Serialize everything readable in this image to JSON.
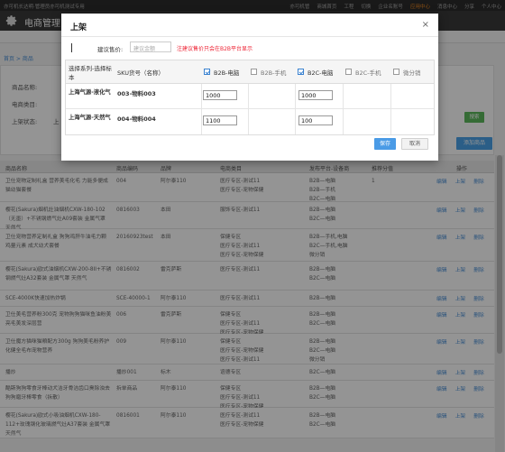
{
  "topbar": {
    "left_text": "亦可机长达明·管理员亦可机测试专用",
    "links": [
      "亦可机管",
      "商城首页",
      "工程",
      "切换",
      "企业名账号",
      "应用中心",
      "消息中心",
      "分享",
      "个人中心"
    ],
    "active_index": 5
  },
  "header": {
    "title": "电商管理"
  },
  "breadcrumb": "首页 > 商品",
  "form": {
    "goods_name_label": "商品名称:",
    "category_label": "电商类目:",
    "status_label": "上架状态:",
    "status_option": "上",
    "search_button": "搜索",
    "add_button": "添加商品"
  },
  "bg_table": {
    "headers": [
      "商品名称",
      "商品编码",
      "品牌",
      "电商类目",
      "发布平台-设备商",
      "推荐分值",
      "操作"
    ],
    "rows": [
      {
        "name": "卫仕宠物定制礼盒 营养美毛化毛 力能多便成猫幼猫套餐",
        "code": "004",
        "brand": "阿尔泰110",
        "category": "医疗专区-测试11\n医疗专区-宠物保健",
        "platform": "B2B—电脑\nB2B—手机\nB2C—电脑",
        "score": "1"
      },
      {
        "name": "樱花(Sakura)烟机灶油烟机CXW-180-102（无墨）+不锈钢燃气灶A09套装 金属气罩 天然气",
        "code": "0816003",
        "brand": "本田",
        "category": "服饰专区-测试11",
        "platform": "B2B—电脑\nB2C—电脑",
        "score": ""
      },
      {
        "name": "卫仕宠物营养定制礼盒 狗狗鸡肝牛油毛力颗 鸡量元素 成犬幼犬套餐",
        "code": "20160923test",
        "brand": "本田",
        "category": "保健专区\n医疗专区-测试11\n医疗专区-宠物保健",
        "platform": "B2B—手机,电脑\nB2C—手机,电脑\n微分销",
        "score": ""
      },
      {
        "name": "樱花(Sakura)欧式油烟机CXW-200-8II+不锈钢燃气灶A32套装 金属气罩 天然气",
        "code": "0816002",
        "brand": "雷克萨斯",
        "category": "医疗专区-测试11",
        "platform": "B2B—电脑\nB2C—电脑",
        "score": ""
      },
      {
        "name": "SCE-4000K快速加热炸锅",
        "code": "SCE-40000-1",
        "brand": "阿尔泰110",
        "category": "医疗专区-测试11",
        "platform": "B2B—电脑",
        "score": ""
      },
      {
        "name": "卫仕美毛营养粉300克 宠物狗狗猫咪鱼油粉美亮毛美发深层营",
        "code": "006",
        "brand": "雷克萨斯",
        "category": "保健专区\n医疗专区-测试11\n医疗专区-宠物保健",
        "platform": "B2B—电脑\nB2C—电脑",
        "score": ""
      },
      {
        "name": "卫仕魔方猫咪猫粮配方300g 狗狗美毛粉养护化健全毛布宠物营养",
        "code": "009",
        "brand": "阿尔泰110",
        "category": "保健专区\n医疗专区-宠物保健\n医疗专区-测试11",
        "platform": "B2B—电脑\nB2C—电脑\n微分销",
        "score": ""
      },
      {
        "name": "播炒",
        "code": "播炒001",
        "brand": "标木",
        "category": "谊德专区",
        "platform": "B2C—电脑",
        "score": ""
      },
      {
        "name": "酷斯狗狗零食牙棒动犬洁牙骨洁齿口臭除浊去狗狗磨牙棒零食（拆散）",
        "code": "拆单商品",
        "brand": "阿尔泰110",
        "category": "保健专区\n医疗专区-测试11\n医疗专区-宠物保健",
        "platform": "B2B—电脑\nB2C—电脑",
        "score": ""
      },
      {
        "name": "樱花(Sakura)欧式小吸油烟机CXW-180-112+玫瑰钢化玻璃燃气灶A37套装 金属气罩 天然气",
        "code": "0816001",
        "brand": "阿尔泰110",
        "category": "医疗专区-测试11\n医疗专区-宠物保健",
        "platform": "B2B—电脑\nB2C—电脑",
        "score": ""
      }
    ],
    "actions": [
      "编辑",
      "上架",
      "删除"
    ]
  },
  "modal": {
    "title": "上架",
    "close": "×",
    "price_label": "建议售价:",
    "price_placeholder": "建议金额",
    "price_hint": "注建议售价只会在B2B平台显示",
    "col_series": "选择系列-选择标本",
    "col_sku": "SKU货号（名称）",
    "platforms": [
      {
        "label": "B2B-电脑",
        "checked": true
      },
      {
        "label": "B2B-手机",
        "checked": false
      },
      {
        "label": "B2C-电脑",
        "checked": true
      },
      {
        "label": "B2C-手机",
        "checked": false
      },
      {
        "label": "微分销",
        "checked": false
      }
    ],
    "rows": [
      {
        "series": "上海气源-液化气",
        "sku": "003-物料003",
        "b2b_pc": "1000",
        "b2c_pc": "1000"
      },
      {
        "series": "上海气源-天然气",
        "sku": "004-物料004",
        "b2b_pc": "1100",
        "b2c_pc": "100"
      }
    ],
    "save": "保存",
    "cancel": "取消"
  },
  "colors": {
    "accent": "#4a9be6",
    "hint": "#e22233",
    "overlay": "rgba(0,0,0,0.42)"
  }
}
